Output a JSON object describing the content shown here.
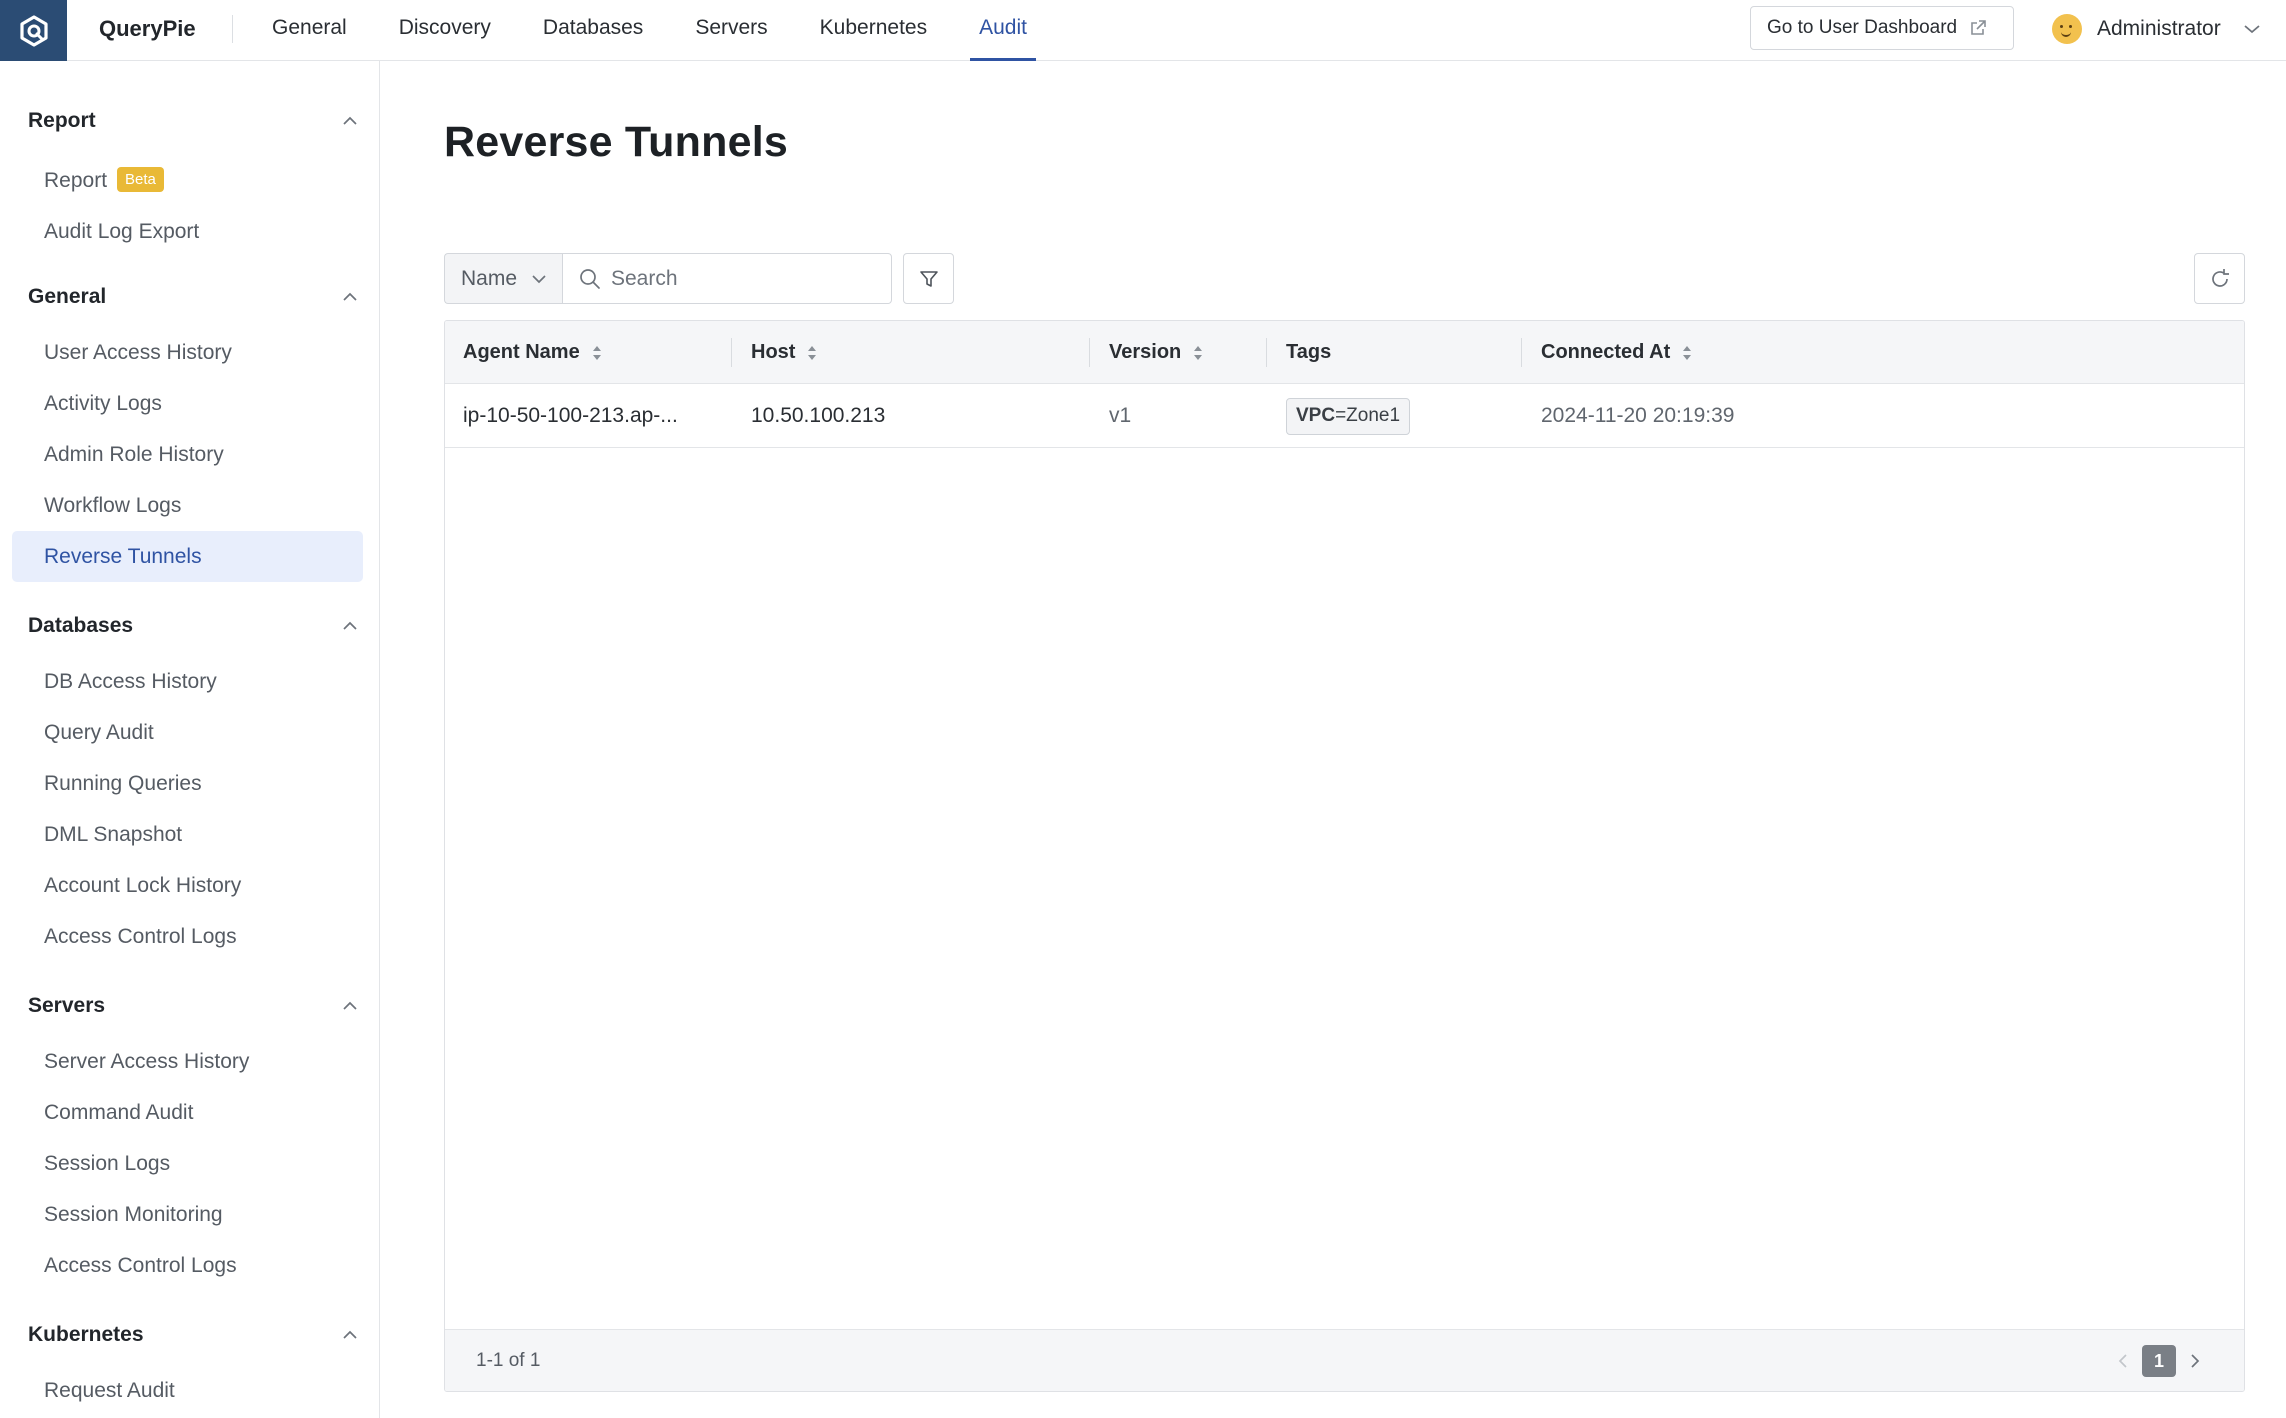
{
  "app": {
    "name": "QueryPie",
    "brand_color": "#2b4c74",
    "accent_color": "#2f53a3"
  },
  "topnav": {
    "items": [
      {
        "label": "General",
        "active": false
      },
      {
        "label": "Discovery",
        "active": false
      },
      {
        "label": "Databases",
        "active": false
      },
      {
        "label": "Servers",
        "active": false
      },
      {
        "label": "Kubernetes",
        "active": false
      },
      {
        "label": "Audit",
        "active": true
      }
    ],
    "dashboard_button": "Go to User Dashboard",
    "user_name": "Administrator"
  },
  "sidebar": {
    "groups": [
      {
        "title": "Report",
        "items": [
          {
            "label": "Report",
            "badge": "Beta"
          },
          {
            "label": "Audit Log Export"
          }
        ]
      },
      {
        "title": "General",
        "items": [
          {
            "label": "User Access History"
          },
          {
            "label": "Activity Logs"
          },
          {
            "label": "Admin Role History"
          },
          {
            "label": "Workflow Logs"
          },
          {
            "label": "Reverse Tunnels",
            "active": true
          }
        ]
      },
      {
        "title": "Databases",
        "items": [
          {
            "label": "DB Access History"
          },
          {
            "label": "Query Audit"
          },
          {
            "label": "Running Queries"
          },
          {
            "label": "DML Snapshot"
          },
          {
            "label": "Account Lock History"
          },
          {
            "label": "Access Control Logs"
          }
        ]
      },
      {
        "title": "Servers",
        "items": [
          {
            "label": "Server Access History"
          },
          {
            "label": "Command Audit"
          },
          {
            "label": "Session Logs"
          },
          {
            "label": "Session Monitoring"
          },
          {
            "label": "Access Control Logs"
          }
        ]
      },
      {
        "title": "Kubernetes",
        "items": [
          {
            "label": "Request Audit"
          }
        ]
      }
    ]
  },
  "main": {
    "title": "Reverse Tunnels",
    "filter": {
      "field_selected": "Name",
      "search_placeholder": "Search"
    },
    "table": {
      "columns": [
        {
          "label": "Agent Name",
          "sortable": true
        },
        {
          "label": "Host",
          "sortable": true
        },
        {
          "label": "Version",
          "sortable": true
        },
        {
          "label": "Tags",
          "sortable": false
        },
        {
          "label": "Connected At",
          "sortable": true
        }
      ],
      "rows": [
        {
          "agent_name": "ip-10-50-100-213.ap-...",
          "host": "10.50.100.213",
          "version": "v1",
          "tag_key": "VPC",
          "tag_value": "=Zone1",
          "connected_at": "2024-11-20 20:19:39"
        }
      ]
    },
    "pagination": {
      "summary": "1-1 of 1",
      "current_page": "1"
    }
  }
}
